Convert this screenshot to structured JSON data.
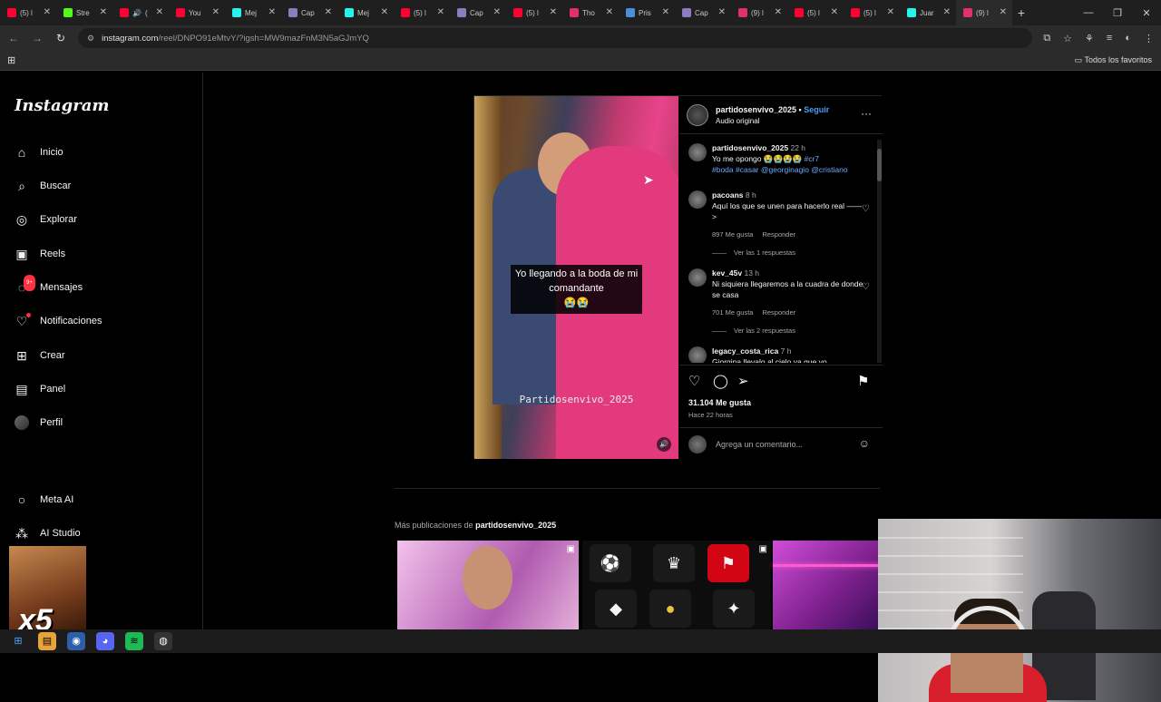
{
  "browser": {
    "tabs": [
      {
        "label": "(5) l",
        "color": "#ff0033"
      },
      {
        "label": "Stre",
        "color": "#53fc18"
      },
      {
        "label": "(",
        "color": "#ff0033",
        "audio": true
      },
      {
        "label": "You",
        "color": "#ff0033"
      },
      {
        "label": "Mej",
        "color": "#25f4ee"
      },
      {
        "label": "Cap",
        "color": "#8e7cc3"
      },
      {
        "label": "Mej",
        "color": "#25f4ee"
      },
      {
        "label": "(5) l",
        "color": "#ff0033"
      },
      {
        "label": "Cap",
        "color": "#8e7cc3"
      },
      {
        "label": "(5) l",
        "color": "#ff0033"
      },
      {
        "label": "Tho",
        "color": "#e1306c"
      },
      {
        "label": "Pris",
        "color": "#4a90d9"
      },
      {
        "label": "Cap",
        "color": "#8e7cc3"
      },
      {
        "label": "(9) l",
        "color": "#e1306c"
      },
      {
        "label": "(5) l",
        "color": "#ff0033"
      },
      {
        "label": "(5) l",
        "color": "#ff0033"
      },
      {
        "label": "Juar",
        "color": "#25f4ee"
      },
      {
        "label": "(9) l",
        "color": "#e1306c"
      }
    ],
    "url_host": "instagram.com",
    "url_path": "/reel/DNPO91eMtvY/?igsh=MW9mazFnM3N5aGJmYQ",
    "bookmarks_label": "Todos los favoritos"
  },
  "instagram": {
    "logo": "Instagram",
    "nav": [
      {
        "label": "Inicio",
        "icon": "home-icon",
        "glyph": "⌂"
      },
      {
        "label": "Buscar",
        "icon": "search-icon",
        "glyph": "⌕"
      },
      {
        "label": "Explorar",
        "icon": "compass-icon",
        "glyph": "◎"
      },
      {
        "label": "Reels",
        "icon": "reels-icon",
        "glyph": "▣"
      },
      {
        "label": "Mensajes",
        "icon": "messenger-icon",
        "glyph": "◌",
        "badge": "9+"
      },
      {
        "label": "Notificaciones",
        "icon": "heart-icon",
        "glyph": "♡",
        "dot": true
      },
      {
        "label": "Crear",
        "icon": "plus-square-icon",
        "glyph": "⊞"
      },
      {
        "label": "Panel",
        "icon": "dashboard-icon",
        "glyph": "▤"
      },
      {
        "label": "Perfil",
        "icon": "avatar",
        "glyph": ""
      }
    ],
    "nav_bottom": [
      {
        "label": "Meta AI",
        "icon": "meta-ai-icon",
        "glyph": "○"
      },
      {
        "label": "AI Studio",
        "icon": "ai-studio-icon",
        "glyph": "⁂"
      }
    ],
    "post": {
      "username": "partidosenvivo_2025",
      "follow": "Seguir",
      "audio": "Audio original",
      "overlay_line1": "Yo llegando a la boda de mi",
      "overlay_line2": "comandante",
      "overlay_emoji": "😭😭",
      "watermark": "Partidosenvivo_2025",
      "likes": "31.104 Me gusta",
      "ago": "Hace 22 horas",
      "add_comment_placeholder": "Agrega un comentario...",
      "caption": {
        "user": "partidosenvivo_2025",
        "time": "22 h",
        "text": "Yo me opongo 😭😭😭😭",
        "tags_inline": "#cr7",
        "tags_line2": "#boda #casar @georginagio @cristiano"
      },
      "comments": [
        {
          "user": "pacoans",
          "time": "8 h",
          "text": "Aquí los que se unen para hacerlo real ——>",
          "likes": "897 Me gusta",
          "reply": "Responder",
          "view_replies": "Ver las 1 respuestas"
        },
        {
          "user": "kev_45v",
          "time": "13 h",
          "text": "Ni siquiera llegaremos a la cuadra de donde se casa",
          "likes": "701 Me gusta",
          "reply": "Responder",
          "view_replies": "Ver las 2 respuestas"
        },
        {
          "user": "legacy_costa_rica",
          "time": "7 h",
          "text": "Giorgina llevalo al cielo ya que yo"
        }
      ]
    },
    "more_posts_prefix": "Más publicaciones de",
    "more_posts_user": "partidosenvivo_2025"
  },
  "overlay": {
    "meme_text": "x5"
  }
}
